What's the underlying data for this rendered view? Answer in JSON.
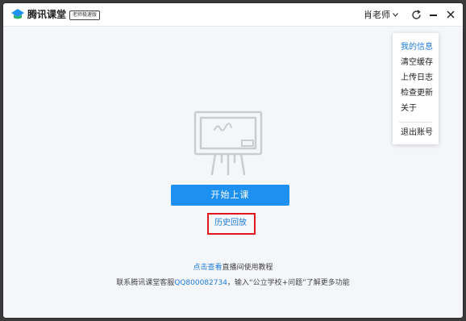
{
  "titlebar": {
    "app_title": "腾讯课堂",
    "edition_badge": "老师极速版",
    "user_name": "肖老师"
  },
  "menu": {
    "items": [
      {
        "label": "我的信息",
        "active": true
      },
      {
        "label": "清空缓存",
        "active": false
      },
      {
        "label": "上传日志",
        "active": false
      },
      {
        "label": "检查更新",
        "active": false
      },
      {
        "label": "关于",
        "active": false
      },
      {
        "label": "退出账号",
        "active": false
      }
    ]
  },
  "main": {
    "start_button": "开始上课",
    "history_link": "历史回放",
    "help": {
      "link": "点击查看",
      "text": "直播间使用教程"
    },
    "contact": {
      "prefix": "联系腾讯课堂客服",
      "qq": "QQ800082734",
      "suffix": "，输入“公立学校+问题”了解更多功能"
    }
  },
  "colors": {
    "accent": "#1e90ef",
    "link": "#1e7bd9",
    "highlight_border": "#e0161c",
    "background": "#f4f6f9"
  },
  "icons": [
    "logo-icon",
    "chevron-down-icon",
    "refresh-icon",
    "minimize-icon",
    "close-icon",
    "whiteboard-icon"
  ]
}
